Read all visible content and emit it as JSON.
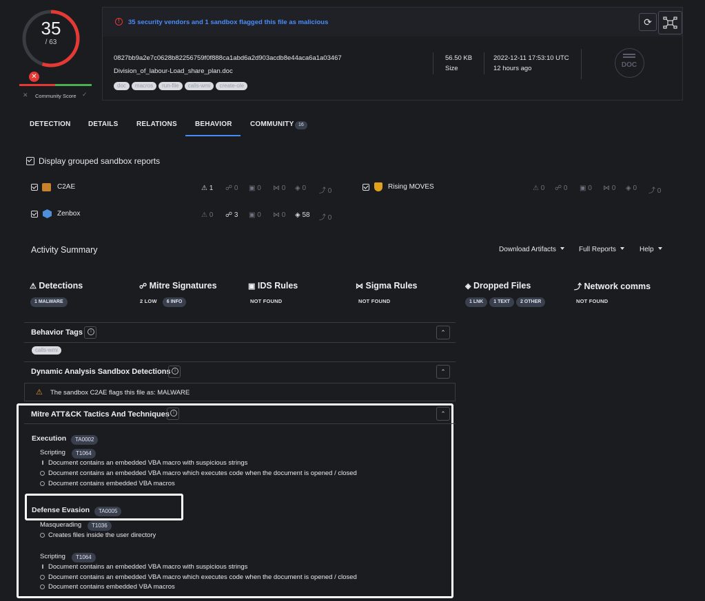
{
  "score": {
    "value": "35",
    "total": "/ 63",
    "community_label": "Community Score"
  },
  "header": {
    "alert": "35 security vendors and 1 sandbox flagged this file as malicious",
    "hash": "0827bb9a2e7c0628b82256759f0f888ca1abd6a2d903acdb8e44aca6a1a03467",
    "filename": "Division_of_labour-Load_share_plan.doc",
    "tags": [
      "doc",
      "macros",
      "run-file",
      "calls-wmi",
      "create-ole"
    ],
    "size_value": "56.50 KB",
    "size_label": "Size",
    "date_value": "2022-12-11 17:53:10 UTC",
    "date_ago": "12 hours ago",
    "filetype": "DOC"
  },
  "tabs": {
    "detection": "DETECTION",
    "details": "DETAILS",
    "relations": "RELATIONS",
    "behavior": "BEHAVIOR",
    "community": "COMMUNITY",
    "community_count": "16"
  },
  "grouped_label": "Display grouped sandbox reports",
  "sandboxes": [
    {
      "name": "C2AE",
      "stats": [
        "1",
        "0",
        "0",
        "0",
        "0",
        "0"
      ]
    },
    {
      "name": "Rising MOVES",
      "stats": [
        "0",
        "0",
        "0",
        "0",
        "0",
        "0"
      ]
    },
    {
      "name": "Zenbox",
      "stats": [
        "0",
        "3",
        "0",
        "0",
        "58",
        "0"
      ]
    }
  ],
  "activity": {
    "title": "Activity Summary",
    "download": "Download Artifacts",
    "full": "Full Reports",
    "help": "Help"
  },
  "categories": {
    "detections": {
      "title": "Detections",
      "pills": [
        "1 MALWARE"
      ]
    },
    "mitre": {
      "title": "Mitre Signatures",
      "pills": [
        "2 LOW",
        "6 INFO"
      ]
    },
    "ids": {
      "title": "IDS Rules",
      "value": "NOT FOUND"
    },
    "sigma": {
      "title": "Sigma Rules",
      "value": "NOT FOUND"
    },
    "dropped": {
      "title": "Dropped Files",
      "pills": [
        "1 LNK",
        "1 TEXT",
        "2 OTHER"
      ]
    },
    "network": {
      "title": "Network comms",
      "value": "NOT FOUND"
    }
  },
  "behavior_tags": {
    "title": "Behavior Tags",
    "tag": "calls-wmi"
  },
  "dynamic": {
    "title": "Dynamic Analysis Sandbox Detections",
    "message": "The sandbox C2AE flags this file as: MALWARE"
  },
  "mitre_section": {
    "title": "Mitre ATT&CK Tactics And Techniques",
    "execution": {
      "name": "Execution",
      "id": "TA0002",
      "technique": "Scripting",
      "technique_id": "T1064",
      "lines": [
        "Document contains an embedded VBA macro with suspicious strings",
        "Document contains an embedded VBA macro which executes code when the document is opened / closed",
        "Document contains embedded VBA macros"
      ]
    },
    "evasion": {
      "name": "Defense Evasion",
      "id": "TA0005",
      "tech1": "Masquerading",
      "tech1_id": "T1036",
      "tech1_lines": [
        "Creates files inside the user directory"
      ],
      "tech2": "Scripting",
      "tech2_id": "T1064",
      "tech2_lines": [
        "Document contains an embedded VBA macro with suspicious strings",
        "Document contains an embedded VBA macro which executes code when the document is opened / closed",
        "Document contains embedded VBA macros"
      ]
    }
  },
  "colors": {
    "accent": "#4a8cf7",
    "danger": "#e53935",
    "ok": "#4caf50",
    "bg": "#1b1c20"
  }
}
